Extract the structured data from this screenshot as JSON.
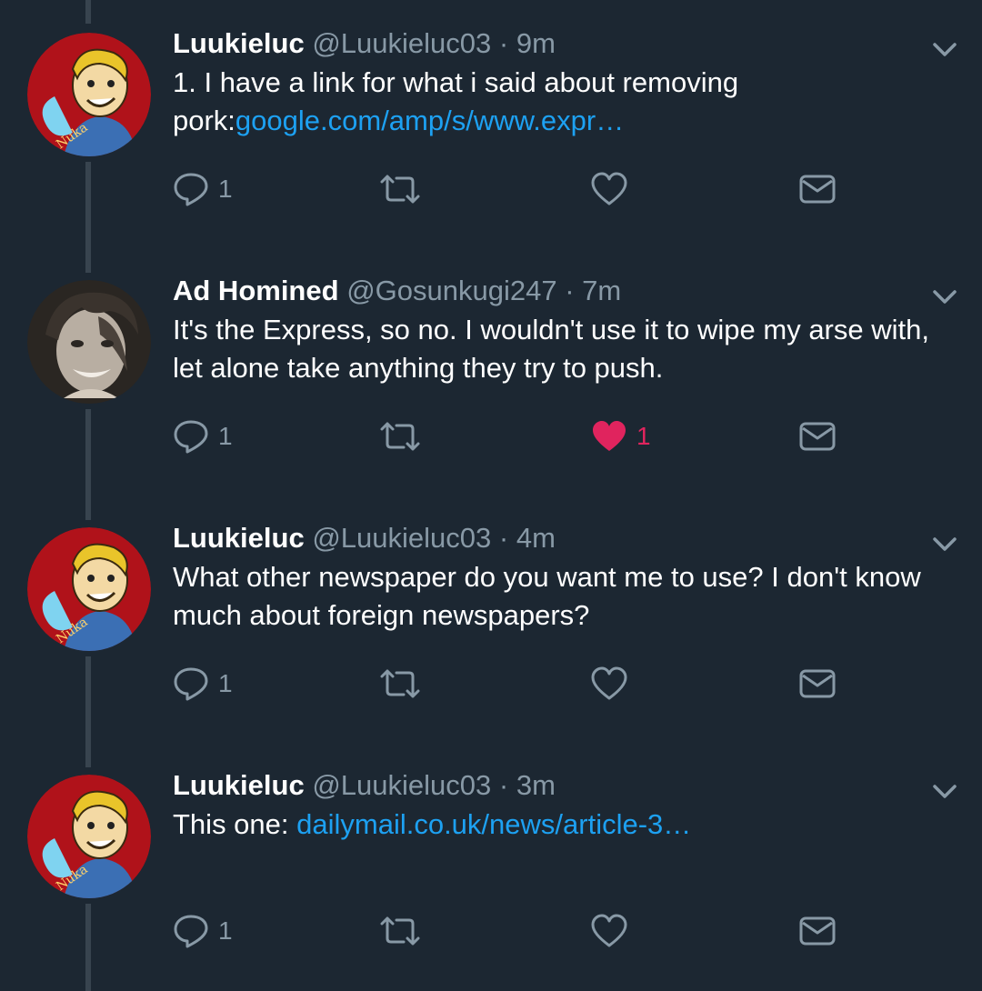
{
  "theme": {
    "background": "#1c2732",
    "thread_line": "#38444f",
    "muted": "#8899a6",
    "link": "#1da1f2",
    "like_active": "#e0245e"
  },
  "tweets": [
    {
      "display_name": "Luukieluc",
      "handle": "@Luukieluc03",
      "separator": "·",
      "time": "9m",
      "text": "1. I have a link for what i said about removing pork:",
      "link": "google.com/amp/s/www.expr…",
      "avatar": "vault-boy-avatar",
      "reply_count": "1",
      "retweet_count": "",
      "like_count": "",
      "liked": false
    },
    {
      "display_name": "Ad Homined",
      "handle": "@Gosunkugi247",
      "separator": "·",
      "time": "7m",
      "text": "It's the Express, so no. I wouldn't use it to wipe my arse with, let alone take anything they try to push.",
      "link": "",
      "avatar": "photo-avatar",
      "reply_count": "1",
      "retweet_count": "",
      "like_count": "1",
      "liked": true
    },
    {
      "display_name": "Luukieluc",
      "handle": "@Luukieluc03",
      "separator": "·",
      "time": "4m",
      "text": "What other newspaper do you want me to use? I don't know much about foreign newspapers?",
      "link": "",
      "avatar": "vault-boy-avatar",
      "reply_count": "1",
      "retweet_count": "",
      "like_count": "",
      "liked": false
    },
    {
      "display_name": "Luukieluc",
      "handle": "@Luukieluc03",
      "separator": "·",
      "time": "3m",
      "text": "This one: ",
      "link": "dailymail.co.uk/news/article-3…",
      "avatar": "vault-boy-avatar",
      "reply_count": "1",
      "retweet_count": "",
      "like_count": "",
      "liked": false
    }
  ],
  "icons": {
    "reply": "reply-icon",
    "retweet": "retweet-icon",
    "like": "heart-icon",
    "dm": "envelope-icon",
    "more": "chevron-down-icon"
  }
}
